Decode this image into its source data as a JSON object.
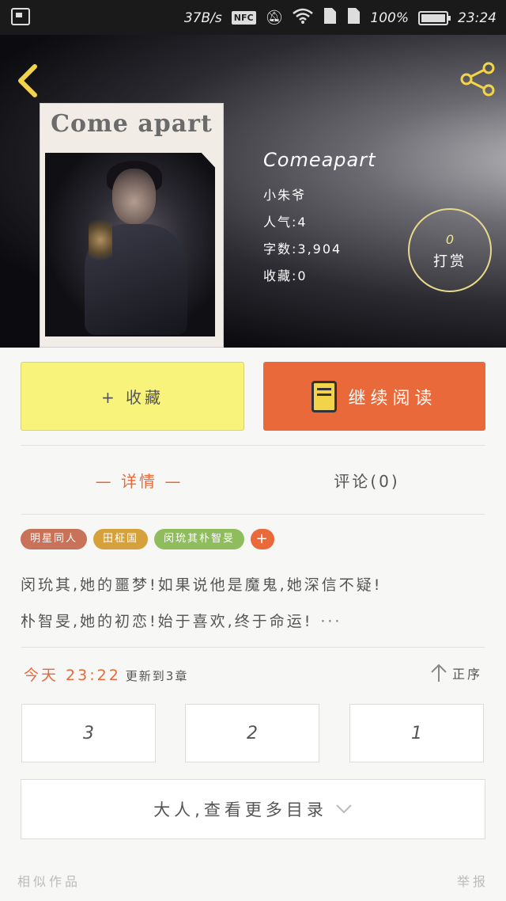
{
  "status_bar": {
    "speed": "37B/s",
    "nfc": "NFC",
    "battery": "100%",
    "time": "23:24",
    "icons": [
      "image-icon",
      "nfc-icon",
      "mute-icon",
      "wifi-icon",
      "sim1-icon",
      "sim2-icon",
      "battery-icon"
    ]
  },
  "hero": {
    "cover_title": "Come apart",
    "book_name": "Comeapart",
    "author": "小朱爷",
    "popularity": "人气:4",
    "word_count": "字数:3,904",
    "favorites": "收藏:0",
    "reward_count": "0",
    "reward_label": "打赏"
  },
  "actions": {
    "favorite_label": "+ 收藏",
    "read_label": "继续阅读"
  },
  "tabs": {
    "detail": "— 详情 —",
    "comments": "评论(0)"
  },
  "tags": [
    {
      "label": "明星同人",
      "color": "#c9725a"
    },
    {
      "label": "田柾国",
      "color": "#d4a13c"
    },
    {
      "label": "闵玧其朴智旻",
      "color": "#8fbd5e"
    },
    {
      "label": "+",
      "color": "#e9693a"
    }
  ],
  "synopsis": {
    "line1": "闵玧其,她的噩梦!如果说他是魔鬼,她深信不疑!",
    "line2": "朴智旻,她的初恋!始于喜欢,终于命运!",
    "more": "···"
  },
  "update": {
    "today": "今天 23:22",
    "text": "更新到3章",
    "sort_label": "正序"
  },
  "chapters": [
    "3",
    "2",
    "1"
  ],
  "more_catalog": "大人,查看更多目录",
  "footer": {
    "similar": "相似作品",
    "report": "举报"
  },
  "colors": {
    "accent": "#e9693a",
    "favorite_bg": "#f8f37a",
    "reward_ring": "#e8d98b"
  }
}
